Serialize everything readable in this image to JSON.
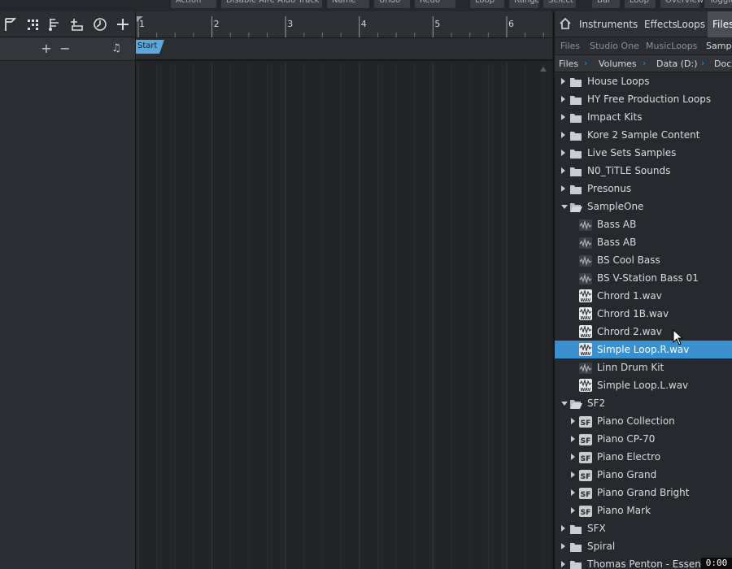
{
  "top_toolbar": {
    "buttons": [
      "Action",
      "Disable Aire Aido Track",
      "Name",
      "Undo",
      "Redo",
      "Loop",
      "Range",
      "Select",
      "Bar",
      "Loop",
      "Overview",
      "Toggle"
    ]
  },
  "track_toolbar": {
    "icons": [
      "flag-icon",
      "quantize-icon",
      "note-tools-icon",
      "track-add-icon",
      "tempo-clock-icon",
      "add-icon"
    ]
  },
  "track_controls": {
    "add_label": "+",
    "remove_label": "−",
    "note_label": "♫"
  },
  "ruler": {
    "bars": [
      "1",
      "2",
      "3",
      "4",
      "5",
      "6"
    ]
  },
  "marker": {
    "start_label": "Start",
    "color": "#5aa8e0"
  },
  "browser": {
    "tabs": [
      "Instruments",
      "Effects",
      "Loops",
      "Files"
    ],
    "active_tab": "Files",
    "subtabs": [
      "Files",
      "Studio One",
      "MusicLoops",
      "Sampl"
    ],
    "breadcrumb": [
      "Files",
      "Volumes",
      "Data (D:)",
      "Docu"
    ],
    "accent": "#2f8fd0",
    "selected_color": "#3a8fcf",
    "items": [
      {
        "label": "House Loops",
        "type": "folder",
        "level": 0,
        "expander": "collapsed"
      },
      {
        "label": "HY Free Production Loops",
        "type": "folder",
        "level": 0,
        "expander": "collapsed"
      },
      {
        "label": "Impact Kits",
        "type": "folder",
        "level": 0,
        "expander": "collapsed"
      },
      {
        "label": "Kore 2 Sample Content",
        "type": "folder",
        "level": 0,
        "expander": "collapsed"
      },
      {
        "label": "Live Sets Samples",
        "type": "folder",
        "level": 0,
        "expander": "collapsed"
      },
      {
        "label": "N0_TiTLE Sounds",
        "type": "folder",
        "level": 0,
        "expander": "collapsed"
      },
      {
        "label": "Presonus",
        "type": "folder",
        "level": 0,
        "expander": "collapsed"
      },
      {
        "label": "SampleOne",
        "type": "folder-open",
        "level": 0,
        "expander": "expanded"
      },
      {
        "label": "Bass AB",
        "type": "sampleone",
        "level": 1,
        "expander": "none"
      },
      {
        "label": "Bass AB",
        "type": "sampleone",
        "level": 1,
        "expander": "none"
      },
      {
        "label": "BS Cool Bass",
        "type": "sampleone",
        "level": 1,
        "expander": "none"
      },
      {
        "label": "BS V-Station Bass 01",
        "type": "sampleone",
        "level": 1,
        "expander": "none"
      },
      {
        "label": "Chrord 1.wav",
        "type": "wav",
        "level": 1,
        "expander": "none"
      },
      {
        "label": "Chrord 1B.wav",
        "type": "wav",
        "level": 1,
        "expander": "none"
      },
      {
        "label": "Chrord 2.wav",
        "type": "wav",
        "level": 1,
        "expander": "none"
      },
      {
        "label": "Simple Loop.R.wav",
        "type": "wav",
        "level": 1,
        "expander": "none",
        "selected": true
      },
      {
        "label": "Linn Drum Kit",
        "type": "sampleone",
        "level": 1,
        "expander": "none"
      },
      {
        "label": "Simple Loop.L.wav",
        "type": "wav",
        "level": 1,
        "expander": "none"
      },
      {
        "label": "SF2",
        "type": "folder-open",
        "level": 0,
        "expander": "expanded"
      },
      {
        "label": "Piano Collection",
        "type": "sf2",
        "level": 1,
        "expander": "collapsed"
      },
      {
        "label": "Piano CP-70",
        "type": "sf2",
        "level": 1,
        "expander": "collapsed"
      },
      {
        "label": "Piano Electro",
        "type": "sf2",
        "level": 1,
        "expander": "collapsed"
      },
      {
        "label": "Piano Grand",
        "type": "sf2",
        "level": 1,
        "expander": "collapsed"
      },
      {
        "label": "Piano Grand Bright",
        "type": "sf2",
        "level": 1,
        "expander": "collapsed"
      },
      {
        "label": "Piano Mark",
        "type": "sf2",
        "level": 1,
        "expander": "collapsed"
      },
      {
        "label": "SFX",
        "type": "folder",
        "level": 0,
        "expander": "collapsed"
      },
      {
        "label": "Spiral",
        "type": "folder",
        "level": 0,
        "expander": "collapsed"
      },
      {
        "label": "Thomas Penton - Essenti",
        "type": "folder",
        "level": 0,
        "expander": "collapsed"
      }
    ]
  },
  "recording_time": "0:00"
}
